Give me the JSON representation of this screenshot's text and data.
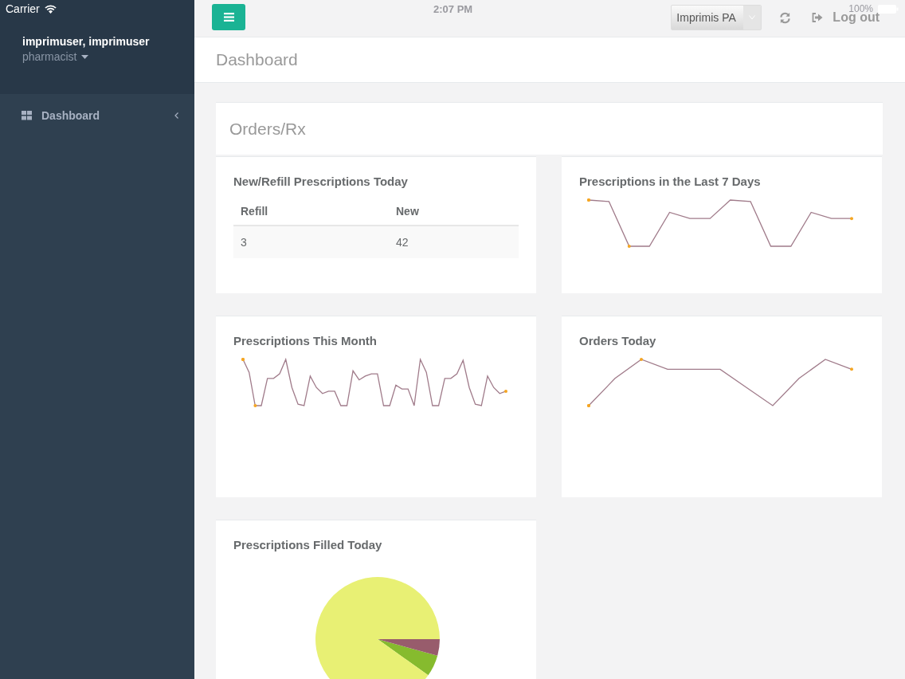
{
  "status_bar": {
    "carrier": "Carrier",
    "time": "2:07 PM",
    "battery": "100%"
  },
  "sidebar": {
    "user_name": "imprimuser, imprimuser",
    "role": "pharmacist",
    "items": [
      {
        "label": "Dashboard",
        "selected": true
      }
    ]
  },
  "header": {
    "location_select": {
      "value": "Imprimis PA"
    },
    "logout": "Log out"
  },
  "page_title": "Dashboard",
  "section": {
    "title": "Orders/Rx",
    "panels": [
      {
        "kind": "table",
        "title": "New/Refill Prescriptions Today",
        "columns": [
          "Refill",
          "New"
        ],
        "rows": [
          [
            "3",
            "42"
          ]
        ]
      },
      {
        "kind": "sparkline",
        "title": "Prescriptions in the Last 7 Days"
      },
      {
        "kind": "sparkline",
        "title": "Prescriptions This Month"
      },
      {
        "kind": "sparkline",
        "title": "Orders Today"
      },
      {
        "kind": "pie",
        "title": "Prescriptions Filled Today"
      }
    ]
  }
}
